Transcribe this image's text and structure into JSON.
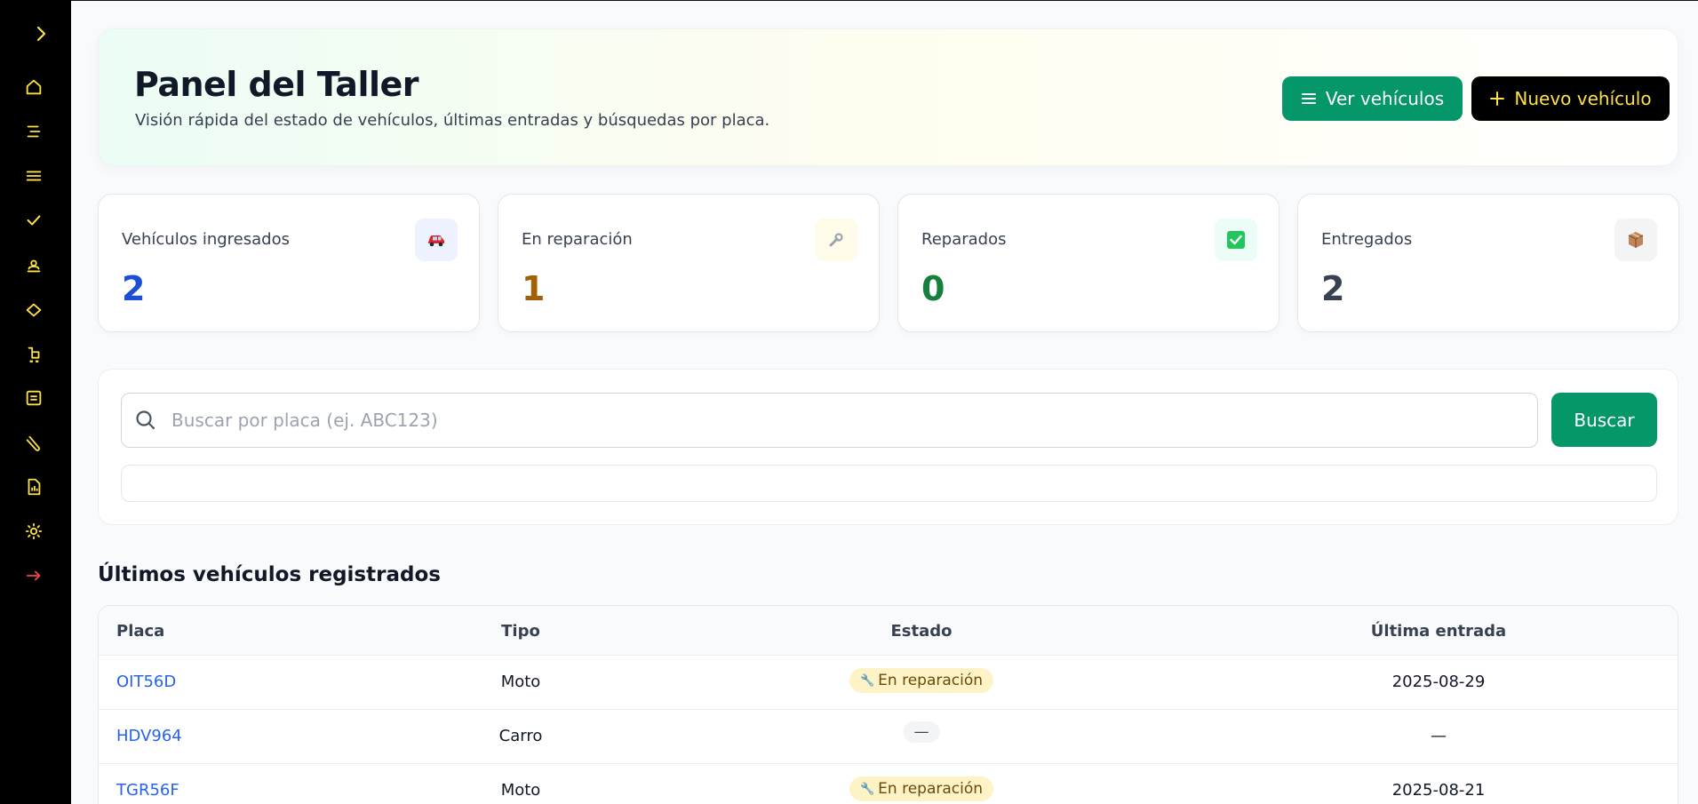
{
  "header": {
    "title": "Panel del Taller",
    "subtitle": "Visión rápida del estado de vehículos, últimas entradas y búsquedas por placa.",
    "view_button": "Ver vehículos",
    "new_button": "Nuevo vehículo"
  },
  "stats": [
    {
      "label": "Vehículos ingresados",
      "value": "2",
      "icon": "car-icon",
      "color": "#1d4ed8"
    },
    {
      "label": "En reparación",
      "value": "1",
      "icon": "wrench-icon",
      "color": "#a16207"
    },
    {
      "label": "Reparados",
      "value": "0",
      "icon": "check-icon",
      "color": "#15803d"
    },
    {
      "label": "Entregados",
      "value": "2",
      "icon": "package-icon",
      "color": "#374151"
    }
  ],
  "search": {
    "placeholder": "Buscar por placa (ej. ABC123)",
    "button": "Buscar"
  },
  "recent": {
    "title": "Últimos vehículos registrados",
    "columns": [
      "Placa",
      "Tipo",
      "Estado",
      "Última entrada"
    ],
    "rows": [
      {
        "plate": "OIT56D",
        "type": "Moto",
        "status": "En reparación",
        "last_entry": "2025-08-29"
      },
      {
        "plate": "HDV964",
        "type": "Carro",
        "status": "—",
        "last_entry": "—"
      },
      {
        "plate": "TGR56F",
        "type": "Moto",
        "status": "En reparación",
        "last_entry": "2025-08-21"
      }
    ]
  },
  "colors": {
    "accent_green": "#059669",
    "sidebar_icon": "#fde047",
    "logout_icon": "#ef4444"
  }
}
